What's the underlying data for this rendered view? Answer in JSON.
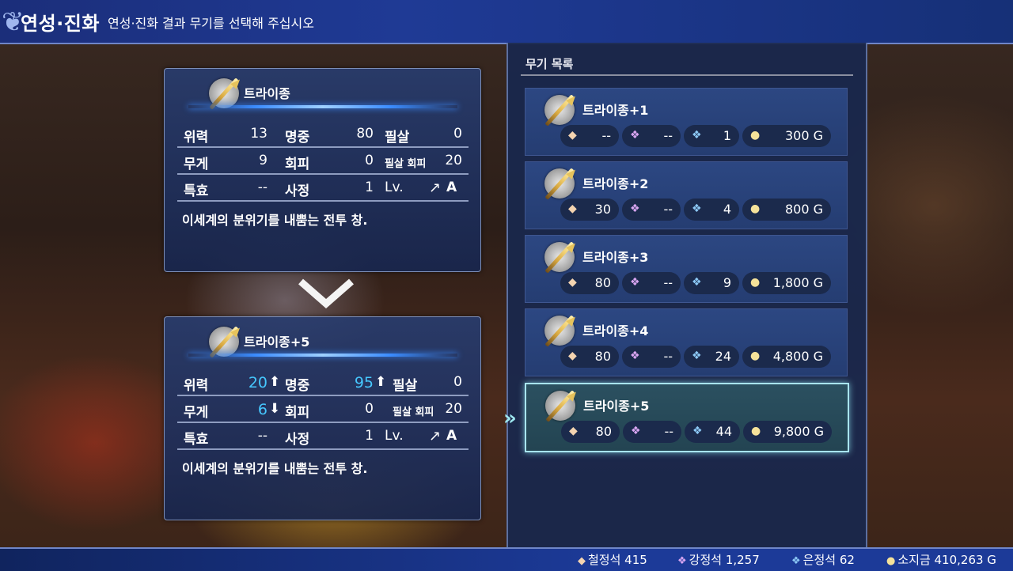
{
  "header": {
    "title": "연성·진화",
    "subtitle": "연성·진화 결과 무기를 선택해 주십시오"
  },
  "current": {
    "name": "트라이종",
    "stats": [
      {
        "l1": "위력",
        "v1": "13",
        "l2": "명중",
        "v2": "80",
        "l3": "필살",
        "v3": "0"
      },
      {
        "l1": "무게",
        "v1": "9",
        "l2": "회피",
        "v2": "0",
        "l3": "필살 회피",
        "v3": "20"
      },
      {
        "l1": "특효",
        "v1": "--",
        "l2": "사정",
        "v2": "1",
        "l3": "Lv.",
        "v3": "A"
      }
    ],
    "description": "이세계의 분위기를 내뿜는 전투 창."
  },
  "result": {
    "name": "트라이종+5",
    "stats": [
      {
        "l1": "위력",
        "v1": "20",
        "l2": "명중",
        "v2": "95",
        "l3": "필살",
        "v3": "0"
      },
      {
        "l1": "무게",
        "v1": "6",
        "l2": "회피",
        "v2": "0",
        "l3": "필살 회피",
        "v3": "20"
      },
      {
        "l1": "특효",
        "v1": "--",
        "l2": "사정",
        "v2": "1",
        "l3": "Lv.",
        "v3": "A"
      }
    ],
    "description": "이세계의 분위기를 내뿜는 전투 창."
  },
  "weapon_list": {
    "header": "무기 목록",
    "items": [
      {
        "name": "트라이종+1",
        "iron": "--",
        "steel": "--",
        "silver": "1",
        "gold": "300 G"
      },
      {
        "name": "트라이종+2",
        "iron": "30",
        "steel": "--",
        "silver": "4",
        "gold": "800 G"
      },
      {
        "name": "트라이종+3",
        "iron": "80",
        "steel": "--",
        "silver": "9",
        "gold": "1,800 G"
      },
      {
        "name": "트라이종+4",
        "iron": "80",
        "steel": "--",
        "silver": "24",
        "gold": "4,800 G"
      },
      {
        "name": "트라이종+5",
        "iron": "80",
        "steel": "--",
        "silver": "44",
        "gold": "9,800 G",
        "selected": true
      }
    ]
  },
  "resources": {
    "iron": "철정석 415",
    "steel": "강정석 1,257",
    "silver": "은정석 62",
    "gold": "소지금 410,263 G"
  }
}
